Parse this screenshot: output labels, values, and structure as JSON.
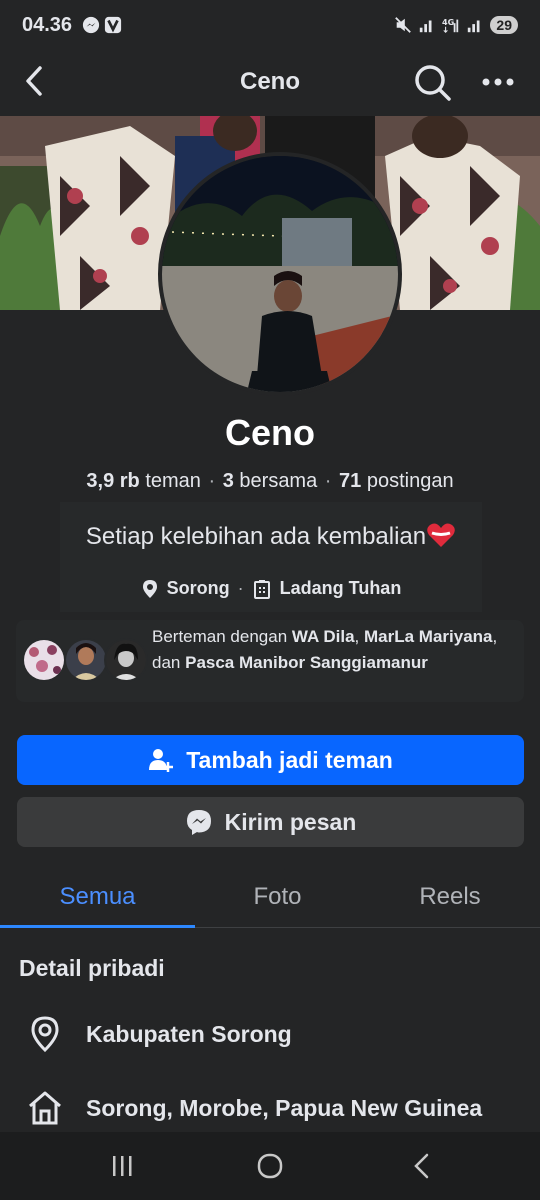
{
  "status_bar": {
    "time": "04.36",
    "battery": "29"
  },
  "header": {
    "title": "Ceno"
  },
  "profile": {
    "name": "Ceno",
    "stats": {
      "friends_count": "3,9 rb",
      "friends_label": "teman",
      "mutual_count": "3",
      "mutual_label": "bersama",
      "posts_count": "71",
      "posts_label": "postingan"
    },
    "bio": "Setiap kelebihan ada kembalian",
    "location": "Sorong",
    "workplace": "Ladang Tuhan"
  },
  "mutual": {
    "prefix": "Berteman dengan",
    "friend1": "WA Dila",
    "friend2": "MarLa Mariyana",
    "connector": "dan",
    "friend3": "Pasca Manibor Sanggiamanur"
  },
  "actions": {
    "add_friend": "Tambah jadi teman",
    "send_message": "Kirim pesan"
  },
  "tabs": [
    {
      "label": "Semua"
    },
    {
      "label": "Foto"
    },
    {
      "label": "Reels"
    }
  ],
  "details": {
    "title": "Detail pribadi",
    "items": [
      {
        "icon": "location-pin-icon",
        "text": "Kabupaten Sorong"
      },
      {
        "icon": "home-icon",
        "text": "Sorong, Morobe, Papua New Guinea"
      }
    ]
  },
  "colors": {
    "accent": "#0866ff",
    "background": "#242526",
    "button_secondary": "#3a3b3c",
    "tab_active": "#4b8fff"
  }
}
